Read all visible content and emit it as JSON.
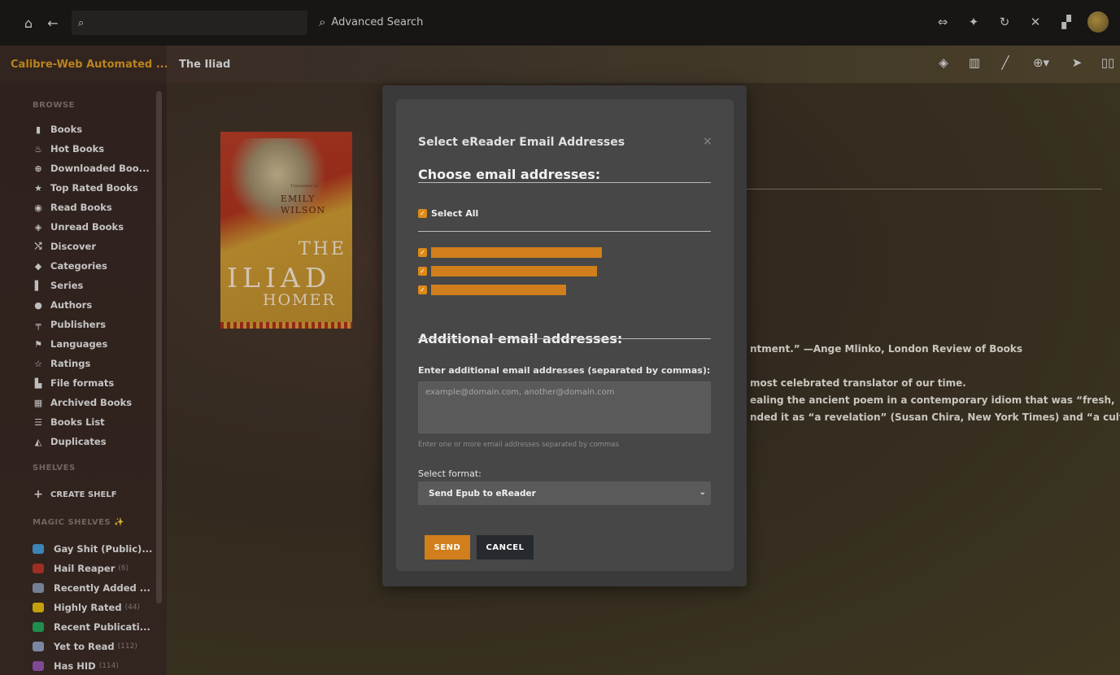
{
  "topbar": {
    "search_placeholder": "",
    "advanced_search_label": "Advanced Search",
    "icons": [
      "home-icon",
      "back-icon",
      "search-icon",
      "sync-icon",
      "activity-icon",
      "refresh-icon",
      "tools-icon",
      "admin-icon"
    ]
  },
  "header": {
    "brand": "Calibre-Web Automated ...",
    "book_title": "The Iliad"
  },
  "sidebar": {
    "browse_heading": "BROWSE",
    "items": [
      {
        "label": "Books",
        "icon": "book-icon",
        "glyph": "▮"
      },
      {
        "label": "Hot Books",
        "icon": "fire-icon",
        "glyph": "♨"
      },
      {
        "label": "Downloaded Boo...",
        "icon": "download-icon",
        "glyph": "⊕"
      },
      {
        "label": "Top Rated Books",
        "icon": "star-icon",
        "glyph": "★"
      },
      {
        "label": "Read Books",
        "icon": "eye-icon",
        "glyph": "◉"
      },
      {
        "label": "Unread Books",
        "icon": "eye-off-icon",
        "glyph": "◈"
      },
      {
        "label": "Discover",
        "icon": "shuffle-icon",
        "glyph": "⤭"
      },
      {
        "label": "Categories",
        "icon": "tags-icon",
        "glyph": "◆"
      },
      {
        "label": "Series",
        "icon": "bookmark-icon",
        "glyph": "▌"
      },
      {
        "label": "Authors",
        "icon": "user-icon",
        "glyph": "●"
      },
      {
        "label": "Publishers",
        "icon": "publisher-icon",
        "glyph": "╤"
      },
      {
        "label": "Languages",
        "icon": "flag-icon",
        "glyph": "⚑"
      },
      {
        "label": "Ratings",
        "icon": "star-outline-icon",
        "glyph": "☆"
      },
      {
        "label": "File formats",
        "icon": "file-icon",
        "glyph": "▙"
      },
      {
        "label": "Archived Books",
        "icon": "trash-icon",
        "glyph": "▦"
      },
      {
        "label": "Books List",
        "icon": "list-icon",
        "glyph": "☰"
      },
      {
        "label": "Duplicates",
        "icon": "duplicates-icon",
        "glyph": "◭"
      }
    ],
    "shelves_heading": "SHELVES",
    "create_shelf": "CREATE SHELF",
    "magic_heading": "MAGIC SHELVES ✨",
    "magic_items": [
      {
        "label": "Gay Shit (Public)...",
        "count": "",
        "color": "#4aa3df"
      },
      {
        "label": "Hail Reaper",
        "count": "(6)",
        "color": "#c0392b"
      },
      {
        "label": "Recently Added ...",
        "count": "",
        "color": "#8e9eb5"
      },
      {
        "label": "Highly Rated",
        "count": "(44)",
        "color": "#f1c40f"
      },
      {
        "label": "Recent Publicati...",
        "count": "",
        "color": "#27ae60"
      },
      {
        "label": "Yet to Read",
        "count": "(112)",
        "color": "#95a5c6"
      },
      {
        "label": "Has HID",
        "count": "(114)",
        "color": "#9b59b6"
      }
    ]
  },
  "book": {
    "cover_translator": "Translated by",
    "cover_author_first": "EMILY",
    "cover_author_last": "WILSON",
    "cover_title_the": "THE",
    "cover_title": "ILIAD",
    "cover_author": "HOMER",
    "desc_lines": [
      "ntment.” —Ange Mlinko, London Review of Books",
      "most celebrated translator of our time.",
      "ealing the ancient poem in a contemporary idiom that was “fresh,",
      "nded it as “a revelation” (Susan Chira, New York Times) and “a cultural"
    ]
  },
  "modal": {
    "title": "Select eReader Email Addresses",
    "close": "×",
    "choose_heading": "Choose email addresses:",
    "select_all": "Select All",
    "additional_heading": "Additional email addresses:",
    "enter_label": "Enter additional email addresses (separated by commas):",
    "textarea_placeholder": "example@domain.com, another@domain.com",
    "help_text": "Enter one or more email addresses separated by commas",
    "format_label": "Select format:",
    "format_value": "Send Epub to eReader",
    "send_label": "SEND",
    "cancel_label": "CANCEL",
    "accent_color": "#d07f1c"
  }
}
